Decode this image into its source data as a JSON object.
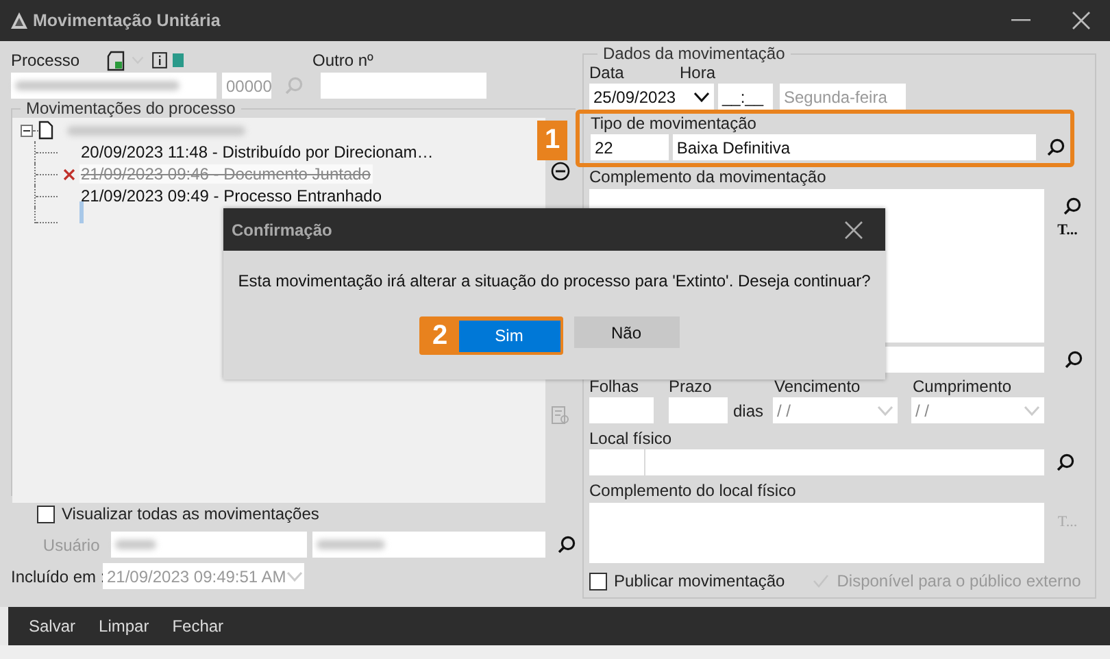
{
  "window": {
    "title": "Movimentação Unitária"
  },
  "process": {
    "label": "Processo",
    "number_suffix": "00000",
    "other_label": "Outro nº"
  },
  "movements": {
    "title": "Movimentações do processo",
    "root_expanded": true,
    "items": [
      {
        "kind": "entry",
        "text": "20/09/2023 11:48 - Distribuído por Direcionam…",
        "deleted": false
      },
      {
        "kind": "entry",
        "text": "21/09/2023 09:46 - Documento Juntado",
        "deleted": true
      },
      {
        "kind": "entry",
        "text": "21/09/2023 09:49 - Processo Entranhado",
        "deleted": false
      },
      {
        "kind": "new"
      }
    ]
  },
  "show_all": {
    "label": "Visualizar todas as movimentações",
    "checked": false
  },
  "user": {
    "label": "Usuário"
  },
  "included": {
    "label": "Incluído em :",
    "value": "21/09/2023 09:49:51 AM"
  },
  "details": {
    "title": "Dados da movimentação",
    "date": {
      "label": "Data",
      "value": "25/09/2023"
    },
    "time": {
      "label": "Hora",
      "value": "__:__"
    },
    "weekday": "Segunda-feira",
    "movement_type": {
      "label": "Tipo de movimentação",
      "code": "22",
      "description": "Baixa Definitiva",
      "callout": "1"
    },
    "complement": {
      "label": "Complemento da movimentação",
      "more": "T..."
    },
    "sheets": {
      "label": "Folhas"
    },
    "deadline": {
      "label": "Prazo",
      "unit": "dias"
    },
    "due": {
      "label": "Vencimento",
      "placeholder": "/ /"
    },
    "fulfillment": {
      "label": "Cumprimento",
      "placeholder": "/ /"
    },
    "location": {
      "label": "Local físico"
    },
    "location_complement": {
      "label": "Complemento do local físico",
      "more": "T..."
    },
    "publish": {
      "label": "Publicar movimentação",
      "checked": false,
      "disabled": false
    },
    "public": {
      "label": "Disponível para o público externo",
      "checked": true,
      "disabled": true
    }
  },
  "dialog": {
    "title": "Confirmação",
    "message": "Esta movimentação irá alterar a situação do processo para 'Extinto'. Deseja continuar?",
    "buttons": [
      {
        "label": "Sim",
        "focused": true,
        "callout": "2"
      },
      {
        "label": "Não",
        "focused": false
      }
    ]
  },
  "actions": [
    "Salvar",
    "Limpar",
    "Fechar"
  ]
}
